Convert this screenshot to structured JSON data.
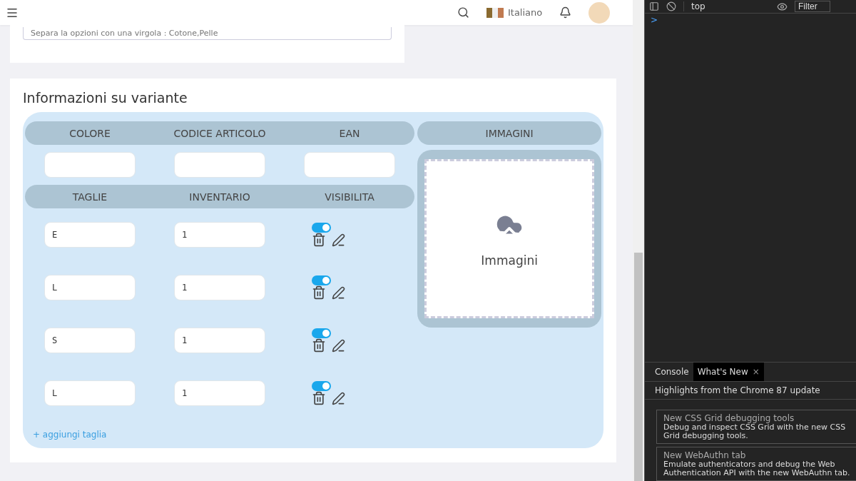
{
  "header": {
    "language": "Italiano"
  },
  "options_field": {
    "placeholder": "Separa la opzioni con una virgola : Cotone,Pelle"
  },
  "variant_section": {
    "title": "Informazioni su variante",
    "columns_top": [
      "COLORE",
      "CODICE ARTICOLO",
      "EAN"
    ],
    "images_header": "IMMAGINI",
    "columns_sizes": [
      "TAGLIE",
      "INVENTARIO",
      "VISIBILITA"
    ],
    "sizes": [
      {
        "size": "E",
        "inventory": "1",
        "visible": true
      },
      {
        "size": "L",
        "inventory": "1",
        "visible": true
      },
      {
        "size": "S",
        "inventory": "1",
        "visible": true
      },
      {
        "size": "L",
        "inventory": "1",
        "visible": true
      }
    ],
    "add_size_link": "+ aggiungi taglia",
    "upload_label": "Immagini"
  },
  "devtools": {
    "context": "top",
    "filter_placeholder": "Filter",
    "prompt": ">",
    "tabs": [
      {
        "label": "Console",
        "selected": false
      },
      {
        "label": "What's New",
        "selected": true
      }
    ],
    "close_tab": "×",
    "highlights_title": "Highlights from the Chrome 87 update",
    "news": [
      {
        "title": "New CSS Grid debugging tools",
        "text": "Debug and inspect CSS Grid with the new CSS Grid debugging tools."
      },
      {
        "title": "New WebAuthn tab",
        "text": "Emulate authenticators and debug the Web Authentication API with the new WebAuthn tab."
      }
    ]
  }
}
